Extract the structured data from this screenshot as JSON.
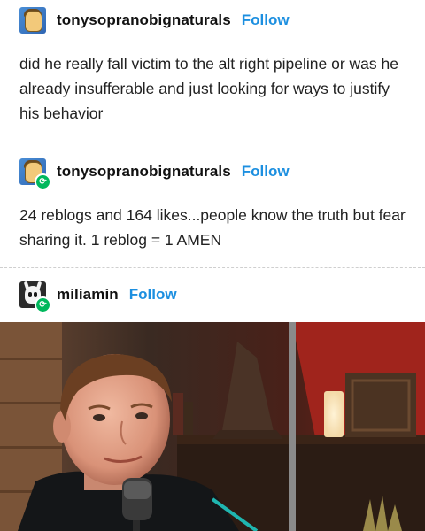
{
  "posts": [
    {
      "username": "tonysopranobignaturals",
      "follow_label": "Follow",
      "text": "did he really fall victim to the alt right pipeline or was he already insufferable and just looking for ways to justify his behavior",
      "avatar_icon": "cartoon-character-avatar",
      "reblog_badge": false
    },
    {
      "username": "tonysopranobignaturals",
      "follow_label": "Follow",
      "text": "24 reblogs and 164 likes...people know the truth but fear sharing it. 1 reblog = 1 AMEN",
      "avatar_icon": "cartoon-character-avatar",
      "reblog_badge": true
    },
    {
      "username": "miliamin",
      "follow_label": "Follow",
      "avatar_icon": "hollow-knight-avatar",
      "reblog_badge": true
    }
  ],
  "colors": {
    "follow": "#1c8fe0",
    "reblog_badge": "#00b85c"
  }
}
